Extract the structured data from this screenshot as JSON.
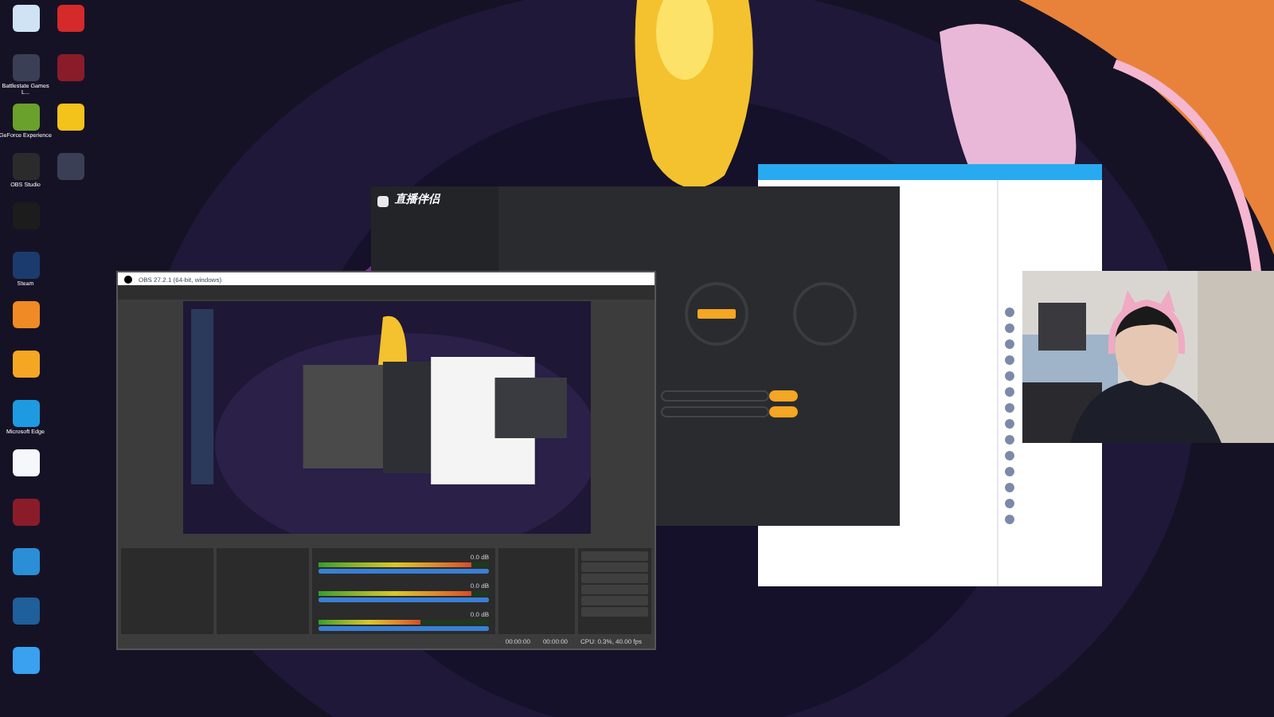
{
  "desktop_icons": {
    "column_1": [
      {
        "kind": "recycle"
      },
      {
        "kind": "game",
        "label": "Battlestate Games L..."
      },
      {
        "kind": "nvidia",
        "label": "GeForce Experience"
      },
      {
        "kind": "obs",
        "label": "OBS Studio"
      },
      {
        "kind": "wifi"
      },
      {
        "kind": "steam",
        "label": "Steam"
      },
      {
        "kind": "orange"
      },
      {
        "kind": "yellow"
      },
      {
        "kind": "edge",
        "label": "Microsoft Edge"
      },
      {
        "kind": "cloud"
      },
      {
        "kind": "red"
      },
      {
        "kind": "globe"
      },
      {
        "kind": "disc"
      },
      {
        "kind": "chat"
      }
    ],
    "column_2": [
      {
        "kind": "music"
      },
      {
        "kind": "red"
      },
      {
        "kind": "owl"
      },
      {
        "kind": "game"
      }
    ]
  },
  "live_app": {
    "logo": "直播伴侣"
  },
  "obs": {
    "title": "OBS 27.2.1 (64-bit, windows)",
    "status": {
      "live_time": "00:00:00",
      "rec_time": "00:00:00",
      "cpu": "CPU: 0.3%, 40.00 fps"
    },
    "meters": [
      {
        "reading": "0.0 dB",
        "level": 0.9,
        "volume": {
          "level": 1
        }
      },
      {
        "reading": "0.0 dB",
        "level": 0.9,
        "volume": {
          "level": 1
        }
      },
      {
        "reading": "0.0 dB",
        "level": 0.6,
        "volume": {
          "level": 1
        }
      }
    ]
  }
}
